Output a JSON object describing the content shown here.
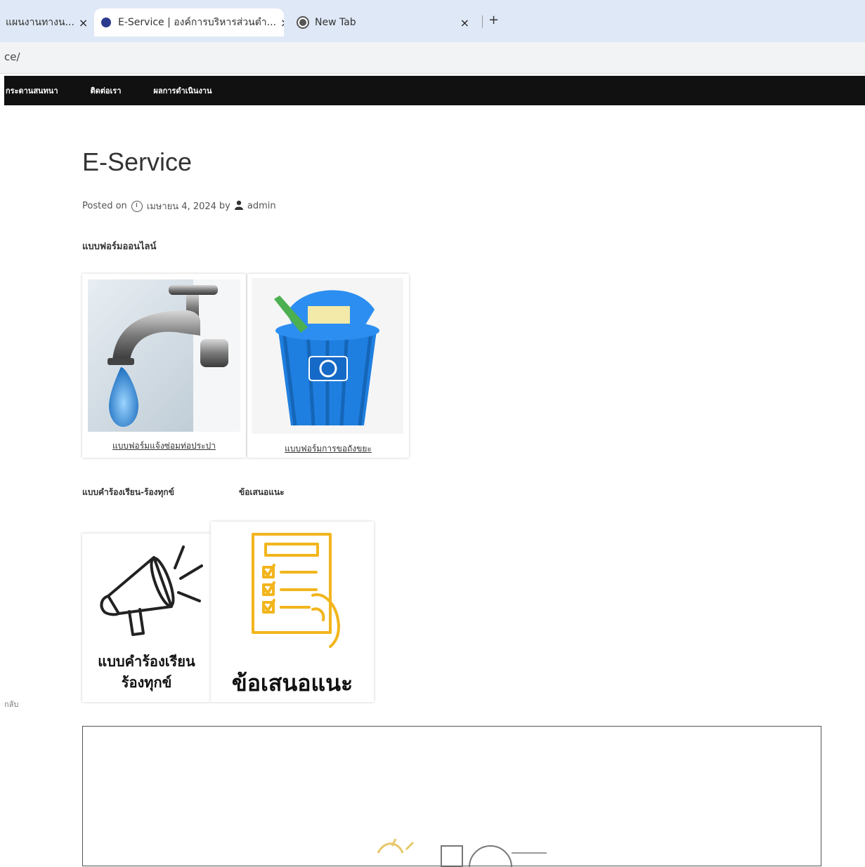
{
  "browser": {
    "tabs": [
      {
        "label": "แผนงานทางน...",
        "close": "×"
      },
      {
        "label": "E-Service | องค์การบริหารส่วนตำ...",
        "close": "×"
      },
      {
        "label": "New Tab",
        "close": "×"
      }
    ],
    "new_tab": "+",
    "address": "ce/"
  },
  "nav": {
    "items": [
      "กระดานสนทนา",
      "ติดต่อเรา",
      "ผลการดำเนินงาน"
    ]
  },
  "post": {
    "title": "E-Service",
    "posted_on_label": "Posted on",
    "date": "เมษายน 4, 2024",
    "by_label": "by",
    "author": "admin"
  },
  "sections": {
    "online_forms_heading": "แบบฟอร์มออนไลน์",
    "water_caption": "แบบฟอร์มแจ้งซ่อมท่อประปา",
    "trash_caption": "แบบฟอร์มการขอถังขยะ",
    "complaint_heading": "แบบคำร้องเรียน-ร้องทุกข์",
    "suggest_heading": "ข้อเสนอแนะ",
    "complaint_card_line1": "แบบคำร้องเรียน",
    "complaint_card_line2": "ร้องทุกข์",
    "suggest_card_text": "ข้อเสนอแนะ"
  },
  "side_text": "กลับ",
  "colors": {
    "nav_bg": "#111111",
    "tabbar_bg": "#dfe8f6",
    "bin_blue": "#1f7fe0",
    "doc_yellow": "#f2b51c"
  },
  "icons": [
    "tab-favicon-icon",
    "chrome-icon",
    "clock-icon",
    "user-icon",
    "megaphone-icon",
    "document-hand-icon",
    "water-tap-image",
    "recycle-bin-image"
  ]
}
